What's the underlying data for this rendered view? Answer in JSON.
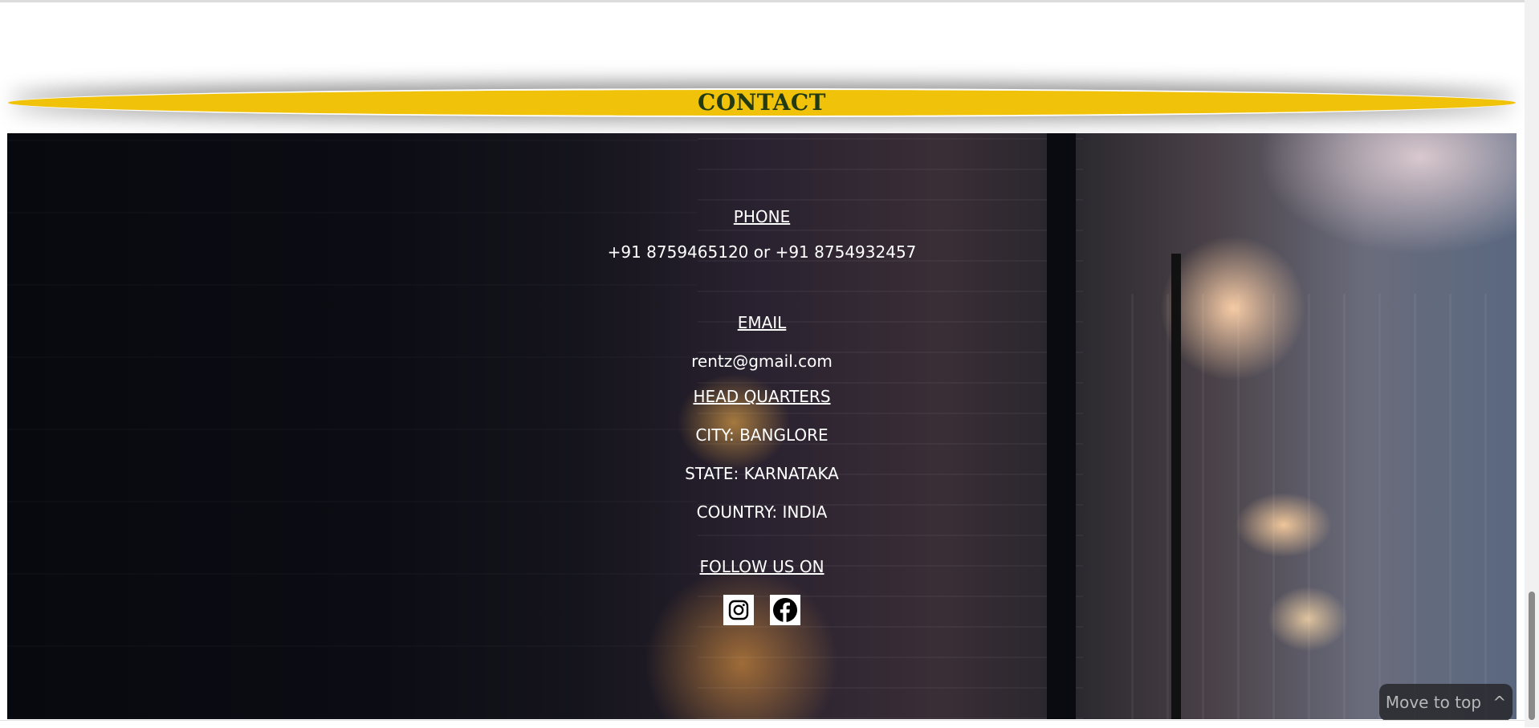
{
  "section_title": "CONTACT",
  "phone": {
    "heading": "PHONE",
    "value": "+91 8759465120 or +91 8754932457"
  },
  "email": {
    "heading": "EMAIL",
    "value": "rentz@gmail.com"
  },
  "headquarters": {
    "heading": "HEAD QUARTERS",
    "city": "CITY: BANGLORE",
    "state": "STATE: KARNATAKA",
    "country": "COUNTRY: INDIA"
  },
  "social": {
    "heading": "FOLLOW US ON",
    "icons": [
      "instagram-icon",
      "facebook-icon"
    ]
  },
  "move_to_top": {
    "label": "Move to top",
    "glyph": "^"
  },
  "colors": {
    "band": "#f0c20a",
    "title": "#223a12",
    "text": "#ffffff"
  }
}
